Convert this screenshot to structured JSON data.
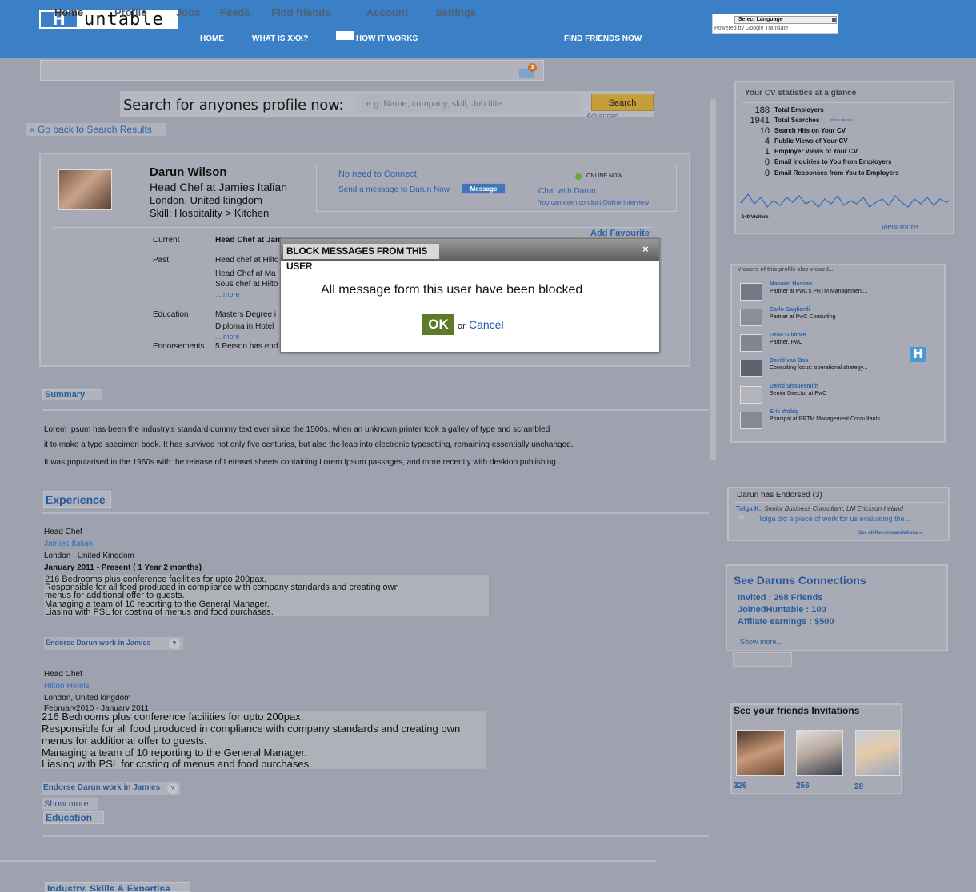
{
  "brand": {
    "logo_letter": "H",
    "logo_text": "untable"
  },
  "topnav": {
    "home": "HOME",
    "what_is": "WHAT IS XXX?",
    "how_it_works": "HOW IT WORKS",
    "find_friends": "FIND FRIENDS NOW"
  },
  "language": {
    "select_label": "Select Language",
    "powered_by": "Powered by Google Translate"
  },
  "tabs": [
    "Home",
    "Profile",
    "Jobs",
    "Feeds",
    "Find friends",
    "Account",
    "Settings"
  ],
  "mail_count": "3",
  "search": {
    "label": "Search for anyones profile now:",
    "placeholder": "e.g: Name, company, skill, Job title",
    "button": "Search",
    "advanced": "Advanced"
  },
  "back_link": "« Go back to Search Results",
  "profile": {
    "name": "Darun Wilson",
    "title": "Head Chef at Jamies Italian",
    "location": "London, United kingdom",
    "skill": "Skill: Hospitality > Kitchen",
    "connect": {
      "no_need": "No need to Connect",
      "send_msg": "Send a message to Darun Now",
      "message_btn": "Message",
      "online": "ONLINE NOW",
      "chat": "Chat with Darun",
      "interview": "You can even conduct Online Interview"
    },
    "add_fav": "Add Favourite",
    "rows": [
      {
        "label": "Current",
        "lines": [
          "Head Chef at Jam"
        ]
      },
      {
        "label": "Past",
        "lines": [
          "Head chef at Hilto",
          "Head Chef at Ma",
          "Sous chef at Hilto"
        ],
        "more": "....more"
      },
      {
        "label": "Education",
        "lines": [
          "Masters Degree i",
          "Diploma in Hotel"
        ],
        "more": "....more"
      },
      {
        "label": "Endorsements",
        "lines": [
          "5 Person has end"
        ]
      }
    ]
  },
  "summary": {
    "title": "Summary",
    "lines": [
      "Lorem Ipsum has been the industry's standard dummy text ever since the 1500s, when an unknown printer took a galley of type and scrambled",
      " it to make a type specimen book. It has survived not only five centuries, but also the leap into electronic typesetting, remaining essentially unchanged.",
      "It was popularised in the 1960s with the release of Letraset sheets containing Lorem Ipsum passages, and more recently with desktop publishing."
    ]
  },
  "experience": {
    "title": "Experience",
    "jobs": [
      {
        "role": "Head Chef",
        "company": "Jamies Italian",
        "location": "London , United Kingdom",
        "period": "January 2011 - Present ( 1 Year 2 months)",
        "desc": [
          "216 Bedrooms plus conference facilities for upto 200pax.",
          "Responsible for all food produced in compliance with company standards and creating own",
          "menus for additional offer to guests.",
          "Managing a team of 10 reporting to the General Manager.",
          "Liasing with PSL for costing of menus and food purchases."
        ],
        "endorse": "Endorse Darun work in Jamies"
      },
      {
        "role": "Head Chef",
        "company": "Hilton Hotels",
        "location": "London, United kingdom",
        "period": "February2010 - January 2011",
        "desc": [
          "216 Bedrooms plus conference facilities for upto 200pax.",
          "Responsible for all food produced in compliance with company standards and creating own",
          "menus for additional offer to guests.",
          "Managing a team of 10 reporting to the General Manager.",
          "Liasing with PSL for costing of menus and food purchases."
        ],
        "endorse": "Endorse Darun work in Jamies"
      }
    ],
    "show_more": "Show more..."
  },
  "education_title": "Education",
  "industry_title": "Industry, Skills & Expertise",
  "cv_stats": {
    "title": "Your CV statistics at a glance",
    "rows": [
      {
        "num": "188",
        "label": "Total Employers"
      },
      {
        "num": "1941",
        "label": "Total Searches",
        "extra": "show details"
      },
      {
        "num": "10",
        "label": "Search Hits on Your CV"
      },
      {
        "num": "4",
        "label": "Public Views of Your CV"
      },
      {
        "num": "1",
        "label": "Employer Views of Your CV"
      },
      {
        "num": "0",
        "label": "Email Inquiries to You from Employers"
      },
      {
        "num": "0",
        "label": "Email Responses from You to Employers"
      }
    ],
    "visitors": "140 Visitors",
    "view_more": "view more..."
  },
  "viewers": {
    "title": "Viewers of this profile also viewed...",
    "people": [
      {
        "name": "Masood Hassan",
        "desc": "Partner at PwC's PRTM Management..."
      },
      {
        "name": "Carlo Gagliardi",
        "desc": "Partner at PwC Consulting"
      },
      {
        "name": "Dean Gilmore",
        "desc": "Partner, PwC"
      },
      {
        "name": "David van Oss",
        "desc": "Consulting focus: operational strategy..."
      },
      {
        "name": "David Shouesmith",
        "desc": "Senior Director at PwC"
      },
      {
        "name": "Eric Wobig",
        "desc": "Principal at PRTM Management Consultants"
      }
    ]
  },
  "endorsed": {
    "title": "Darun has Endorsed (3)",
    "person": "Tolga K.,",
    "role": "Senior Business Consultant, LM Ericsson Ireland",
    "quote": "Tolga did a piece of work for us evaluating the...",
    "see_all": "See all Recommendations »"
  },
  "connections": {
    "title": "See Daruns Connections",
    "invited": "Invited : 268 Friends",
    "joined": "JoinedHuntable : 100",
    "affiliate": "Affliate earnings : $500",
    "show_more": "Show more..."
  },
  "invitations": {
    "title": "See your friends Invitations",
    "counts": [
      "326",
      "256",
      "28"
    ]
  },
  "modal": {
    "title": "BLOCK MESSAGES FROM THIS USER",
    "close": "×",
    "message": "All message form this user have been blocked",
    "ok": "OK",
    "or": "or",
    "cancel": "Cancel"
  },
  "colors": {
    "topbar": "#3b7fc6",
    "ok_button": "#5d7a2a",
    "link": "#2a62a7"
  }
}
